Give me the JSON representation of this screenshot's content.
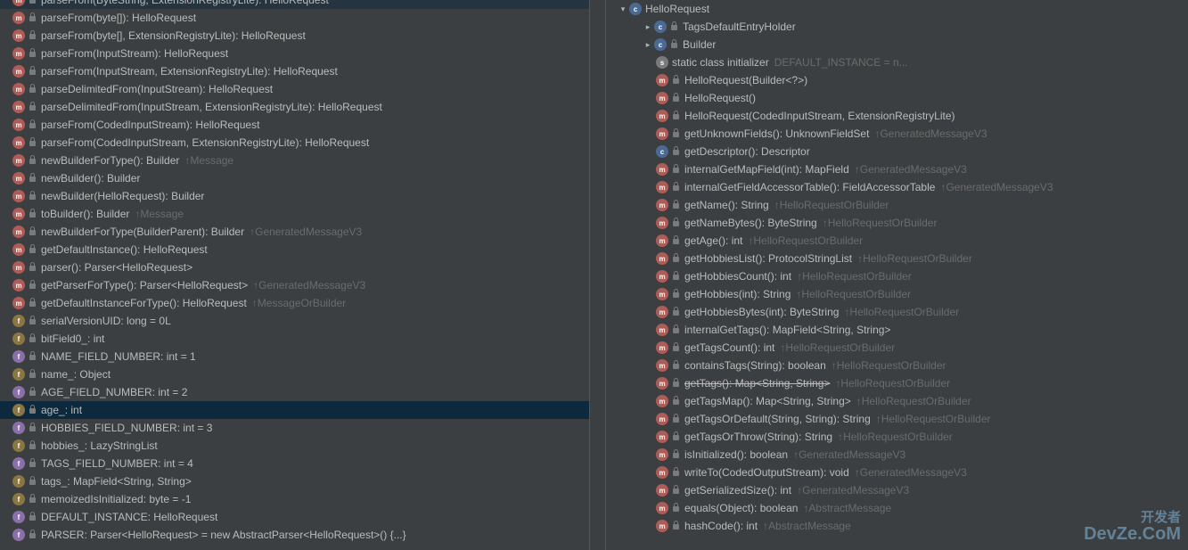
{
  "left_panel": {
    "scroll_top_cut": true,
    "items": [
      {
        "kind": "method",
        "lock": true,
        "label": "parseFrom(ByteString, ExtensionRegistryLite): HelloRequest",
        "cut": true
      },
      {
        "kind": "method",
        "lock": true,
        "label": "parseFrom(byte[]): HelloRequest"
      },
      {
        "kind": "method",
        "lock": true,
        "label": "parseFrom(byte[], ExtensionRegistryLite): HelloRequest"
      },
      {
        "kind": "method",
        "lock": true,
        "label": "parseFrom(InputStream): HelloRequest"
      },
      {
        "kind": "method",
        "lock": true,
        "label": "parseFrom(InputStream, ExtensionRegistryLite): HelloRequest"
      },
      {
        "kind": "method",
        "lock": true,
        "label": "parseDelimitedFrom(InputStream): HelloRequest"
      },
      {
        "kind": "method",
        "lock": true,
        "label": "parseDelimitedFrom(InputStream, ExtensionRegistryLite): HelloRequest"
      },
      {
        "kind": "method",
        "lock": true,
        "label": "parseFrom(CodedInputStream): HelloRequest"
      },
      {
        "kind": "method",
        "lock": true,
        "label": "parseFrom(CodedInputStream, ExtensionRegistryLite): HelloRequest"
      },
      {
        "kind": "method",
        "lock": true,
        "label": "newBuilderForType(): Builder",
        "hint": "↑Message"
      },
      {
        "kind": "method",
        "lock": true,
        "label": "newBuilder(): Builder"
      },
      {
        "kind": "method",
        "lock": true,
        "label": "newBuilder(HelloRequest): Builder"
      },
      {
        "kind": "method",
        "lock": true,
        "label": "toBuilder(): Builder",
        "hint": "↑Message"
      },
      {
        "kind": "method",
        "lock": true,
        "label": "newBuilderForType(BuilderParent): Builder",
        "hint": "↑GeneratedMessageV3"
      },
      {
        "kind": "method",
        "lock": true,
        "label": "getDefaultInstance(): HelloRequest"
      },
      {
        "kind": "method",
        "lock": true,
        "label": "parser(): Parser<HelloRequest>"
      },
      {
        "kind": "method",
        "lock": true,
        "label": "getParserForType(): Parser<HelloRequest>",
        "hint": "↑GeneratedMessageV3"
      },
      {
        "kind": "method",
        "lock": true,
        "label": "getDefaultInstanceForType(): HelloRequest",
        "hint": "↑MessageOrBuilder"
      },
      {
        "kind": "field",
        "lock": true,
        "label": "serialVersionUID: long = 0L"
      },
      {
        "kind": "field",
        "lock": true,
        "label": "bitField0_: int"
      },
      {
        "kind": "field-purple",
        "lock": true,
        "label": "NAME_FIELD_NUMBER: int = 1"
      },
      {
        "kind": "field",
        "lock": true,
        "label": "name_: Object"
      },
      {
        "kind": "field-purple",
        "lock": true,
        "label": "AGE_FIELD_NUMBER: int = 2"
      },
      {
        "kind": "field",
        "lock": true,
        "label": "age_: int",
        "selected": true
      },
      {
        "kind": "field-purple",
        "lock": true,
        "label": "HOBBIES_FIELD_NUMBER: int = 3"
      },
      {
        "kind": "field",
        "lock": true,
        "label": "hobbies_: LazyStringList"
      },
      {
        "kind": "field-purple",
        "lock": true,
        "label": "TAGS_FIELD_NUMBER: int = 4"
      },
      {
        "kind": "field",
        "lock": true,
        "label": "tags_: MapField<String, String>"
      },
      {
        "kind": "field",
        "lock": true,
        "label": "memoizedIsInitialized: byte = -1"
      },
      {
        "kind": "field-purple",
        "lock": true,
        "label": "DEFAULT_INSTANCE: HelloRequest"
      },
      {
        "kind": "field-purple",
        "lock": true,
        "label": "PARSER: Parser<HelloRequest> = new AbstractParser<HelloRequest>() {...}"
      }
    ]
  },
  "right_panel": {
    "root": {
      "arrow": "down",
      "kind": "class",
      "lock": false,
      "label": "HelloRequest"
    },
    "children": [
      {
        "arrow": "right",
        "kind": "class",
        "lock": true,
        "label": "TagsDefaultEntryHolder",
        "indent": 2
      },
      {
        "arrow": "right",
        "kind": "class",
        "lock": true,
        "label": "Builder",
        "indent": 2
      },
      {
        "kind": "static",
        "lock": false,
        "label": "static class initializer",
        "hint": "DEFAULT_INSTANCE = n...",
        "indent": 3
      },
      {
        "kind": "method",
        "lock": true,
        "label": "HelloRequest(Builder<?>)",
        "indent": 3
      },
      {
        "kind": "method",
        "lock": true,
        "label": "HelloRequest()",
        "indent": 3
      },
      {
        "kind": "method",
        "lock": true,
        "label": "HelloRequest(CodedInputStream, ExtensionRegistryLite)",
        "indent": 3
      },
      {
        "kind": "method",
        "lock": true,
        "label": "getUnknownFields(): UnknownFieldSet",
        "hint": "↑GeneratedMessageV3",
        "indent": 3
      },
      {
        "kind": "class",
        "lock": true,
        "label": "getDescriptor(): Descriptor",
        "indent": 3
      },
      {
        "kind": "method",
        "lock": true,
        "label": "internalGetMapField(int): MapField",
        "hint": "↑GeneratedMessageV3",
        "indent": 3
      },
      {
        "kind": "method",
        "lock": true,
        "label": "internalGetFieldAccessorTable(): FieldAccessorTable",
        "hint": "↑GeneratedMessageV3",
        "indent": 3
      },
      {
        "kind": "method",
        "lock": true,
        "label": "getName(): String",
        "hint": "↑HelloRequestOrBuilder",
        "indent": 3
      },
      {
        "kind": "method",
        "lock": true,
        "label": "getNameBytes(): ByteString",
        "hint": "↑HelloRequestOrBuilder",
        "indent": 3
      },
      {
        "kind": "method",
        "lock": true,
        "label": "getAge(): int",
        "hint": "↑HelloRequestOrBuilder",
        "indent": 3
      },
      {
        "kind": "method",
        "lock": true,
        "label": "getHobbiesList(): ProtocolStringList",
        "hint": "↑HelloRequestOrBuilder",
        "indent": 3
      },
      {
        "kind": "method",
        "lock": true,
        "label": "getHobbiesCount(): int",
        "hint": "↑HelloRequestOrBuilder",
        "indent": 3
      },
      {
        "kind": "method",
        "lock": true,
        "label": "getHobbies(int): String",
        "hint": "↑HelloRequestOrBuilder",
        "indent": 3
      },
      {
        "kind": "method",
        "lock": true,
        "label": "getHobbiesBytes(int): ByteString",
        "hint": "↑HelloRequestOrBuilder",
        "indent": 3
      },
      {
        "kind": "method",
        "lock": true,
        "label": "internalGetTags(): MapField<String, String>",
        "indent": 3
      },
      {
        "kind": "method",
        "lock": true,
        "label": "getTagsCount(): int",
        "hint": "↑HelloRequestOrBuilder",
        "indent": 3
      },
      {
        "kind": "method",
        "lock": true,
        "label": "containsTags(String): boolean",
        "hint": "↑HelloRequestOrBuilder",
        "indent": 3
      },
      {
        "kind": "method",
        "lock": true,
        "label": "getTags(): Map<String, String>",
        "hint": "↑HelloRequestOrBuilder",
        "indent": 3,
        "strike": true
      },
      {
        "kind": "method",
        "lock": true,
        "label": "getTagsMap(): Map<String, String>",
        "hint": "↑HelloRequestOrBuilder",
        "indent": 3
      },
      {
        "kind": "method",
        "lock": true,
        "label": "getTagsOrDefault(String, String): String",
        "hint": "↑HelloRequestOrBuilder",
        "indent": 3
      },
      {
        "kind": "method",
        "lock": true,
        "label": "getTagsOrThrow(String): String",
        "hint": "↑HelloRequestOrBuilder",
        "indent": 3
      },
      {
        "kind": "method",
        "lock": true,
        "label": "isInitialized(): boolean",
        "hint": "↑GeneratedMessageV3",
        "indent": 3
      },
      {
        "kind": "method",
        "lock": true,
        "label": "writeTo(CodedOutputStream): void",
        "hint": "↑GeneratedMessageV3",
        "indent": 3
      },
      {
        "kind": "method",
        "lock": true,
        "label": "getSerializedSize(): int",
        "hint": "↑GeneratedMessageV3",
        "indent": 3
      },
      {
        "kind": "method",
        "lock": true,
        "label": "equals(Object): boolean",
        "hint": "↑AbstractMessage",
        "indent": 3
      },
      {
        "kind": "method",
        "lock": true,
        "label": "hashCode(): int",
        "hint": "↑AbstractMessage",
        "indent": 3
      }
    ]
  },
  "watermark": {
    "cn": "开发者",
    "en": "DevZe.CoM"
  },
  "icon_letters": {
    "method": "m",
    "field": "f",
    "field-purple": "f",
    "class": "c",
    "static": "s"
  }
}
